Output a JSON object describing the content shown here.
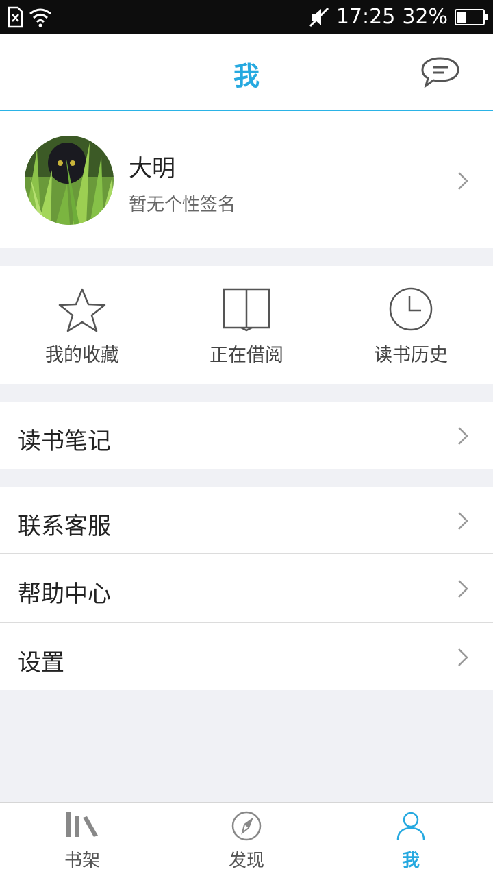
{
  "status_bar": {
    "time": "17:25",
    "battery": "32%",
    "battery_level": 0.32
  },
  "header": {
    "title": "我"
  },
  "profile": {
    "name": "大明",
    "signature": "暂无个性签名"
  },
  "shortcuts": [
    {
      "label": "我的收藏",
      "icon": "star-icon"
    },
    {
      "label": "正在借阅",
      "icon": "open-book-icon"
    },
    {
      "label": "读书历史",
      "icon": "clock-icon"
    }
  ],
  "menu": {
    "notes": "读书笔记",
    "contact": "联系客服",
    "help": "帮助中心",
    "settings": "设置"
  },
  "tabs": [
    {
      "label": "书架",
      "icon": "bookshelf-icon"
    },
    {
      "label": "发现",
      "icon": "compass-icon"
    },
    {
      "label": "我",
      "icon": "person-icon",
      "active": true
    }
  ],
  "colors": {
    "accent": "#26a9e0",
    "background": "#f0f1f5"
  }
}
